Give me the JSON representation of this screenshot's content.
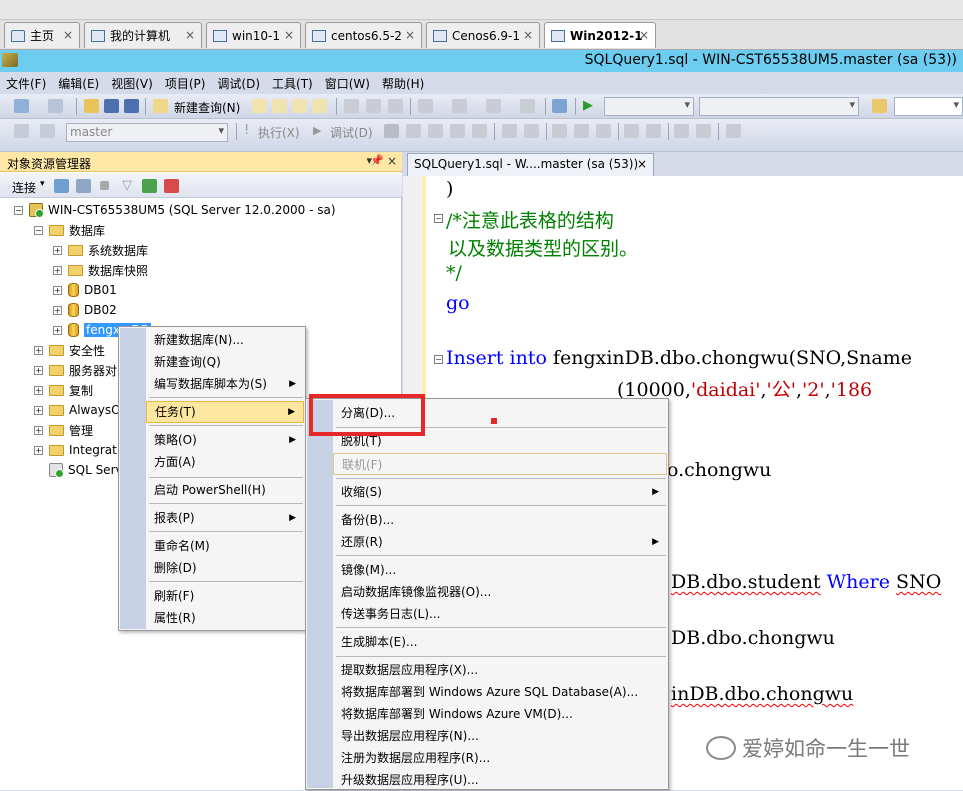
{
  "vm_tabs": [
    {
      "label": "主页"
    },
    {
      "label": "我的计算机"
    },
    {
      "label": "win10-1"
    },
    {
      "label": "centos6.5-2"
    },
    {
      "label": "Cenos6.9-1"
    },
    {
      "label": "Win2012-1",
      "active": true
    }
  ],
  "window": {
    "title": "SQLQuery1.sql - WIN-CST65538UM5.master (sa (53))"
  },
  "menubar": [
    "文件(F)",
    "编辑(E)",
    "视图(V)",
    "项目(P)",
    "调试(D)",
    "工具(T)",
    "窗口(W)",
    "帮助(H)"
  ],
  "toolbar1": {
    "new_query": "新建查询(N)"
  },
  "toolbar2": {
    "database_combo": "master",
    "execute": "执行(X)",
    "debug": "调试(D)"
  },
  "object_explorer": {
    "title": "对象资源管理器",
    "connect": "连接",
    "tree": {
      "server": "WIN-CST65538UM5 (SQL Server 12.0.2000 - sa)",
      "databases": "数据库",
      "system_databases": "系统数据库",
      "snapshots": "数据库快照",
      "db01": "DB01",
      "db02": "DB02",
      "selected_db": "fengx...DB",
      "security": "安全性",
      "server_objects": "服务器对",
      "replication": "复制",
      "alwayson": "AlwaysO",
      "management": "管理",
      "integration": "Integrati",
      "sql_server_agent": "SQL Serv"
    }
  },
  "editor": {
    "tab_label": "SQLQuery1.sql - W....master (sa (53))",
    "lines": {
      "l1": ")",
      "l2": "/*注意此表格的结构",
      "l3": "以及数据类型的区别。",
      "l4": "*/",
      "l5": "go",
      "l6_kw1": "Insert",
      "l6_kw2": "into",
      "l6_rest": "fengxinDB.dbo.chongwu(SNO,Sname",
      "l7_a": "(10000,",
      "l7_s1": "'daidai'",
      "l7_c1": ",",
      "l7_s2": "'公'",
      "l7_c2": ",",
      "l7_s3": "'2'",
      "l7_c3": ",",
      "l7_s4": "'186",
      "l8": "o.chongwu",
      "l9_a": "DB.dbo.student",
      "l9_kw": "Where",
      "l9_b": "SNO",
      "l10": "DB.dbo.chongwu",
      "l11": "inDB.dbo.chongwu"
    }
  },
  "context_menu": {
    "items": [
      "新建数据库(N)...",
      "新建查询(Q)",
      "编写数据库脚本为(S)",
      "任务(T)",
      "策略(O)",
      "方面(A)",
      "启动 PowerShell(H)",
      "报表(P)",
      "重命名(M)",
      "删除(D)",
      "刷新(F)",
      "属性(R)"
    ]
  },
  "tasks_submenu": {
    "items": [
      "分离(D)...",
      "脱机(T)",
      "联机(F)",
      "收缩(S)",
      "备份(B)...",
      "还原(R)",
      "镜像(M)...",
      "启动数据库镜像监视器(O)...",
      "传送事务日志(L)...",
      "生成脚本(E)...",
      "提取数据层应用程序(X)...",
      "将数据库部署到 Windows Azure SQL Database(A)...",
      "将数据库部署到 Windows Azure VM(D)...",
      "导出数据层应用程序(N)...",
      "注册为数据层应用程序(R)...",
      "升级数据层应用程序(U)..."
    ]
  },
  "watermark": "爱婷如命一生一世",
  "colors": {
    "title_bar": "#6ccdf1",
    "highlight": "#fde6a0",
    "annotation_red": "#e5282a",
    "comment_green": "#008000",
    "keyword_blue": "#0000ff",
    "string_red": "#c00000"
  }
}
